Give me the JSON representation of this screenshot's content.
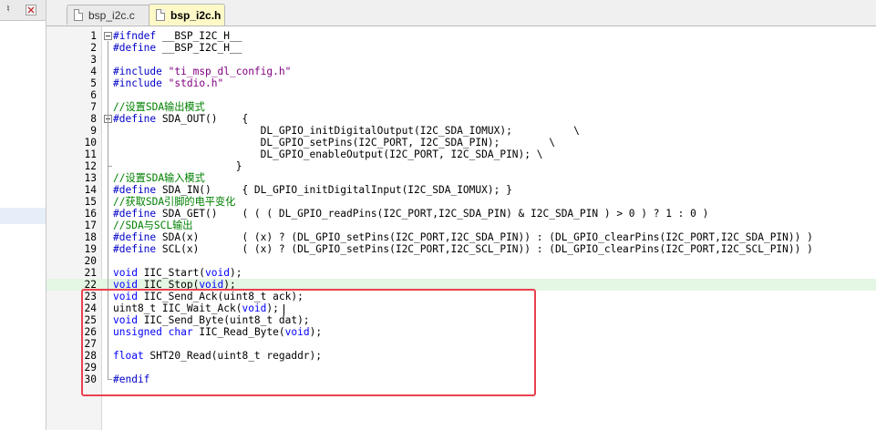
{
  "panel": {
    "pin_icon": "pin-icon",
    "close_icon": "close-icon"
  },
  "tabs": [
    {
      "label": "bsp_i2c.c",
      "active": false
    },
    {
      "label": "bsp_i2c.h",
      "active": true
    }
  ],
  "editor": {
    "current_line": 22,
    "lines": [
      {
        "n": "1",
        "code": "#ifndef __BSP_I2C_H__"
      },
      {
        "n": "2",
        "code": "#define __BSP_I2C_H__"
      },
      {
        "n": "3",
        "code": ""
      },
      {
        "n": "4",
        "code": "#include \"ti_msp_dl_config.h\""
      },
      {
        "n": "5",
        "code": "#include \"stdio.h\""
      },
      {
        "n": "6",
        "code": ""
      },
      {
        "n": "7",
        "code": "//设置SDA输出模式"
      },
      {
        "n": "8",
        "code": "#define SDA_OUT()    {"
      },
      {
        "n": "9",
        "code": "                        DL_GPIO_initDigitalOutput(I2C_SDA_IOMUX);          \\"
      },
      {
        "n": "10",
        "code": "                        DL_GPIO_setPins(I2C_PORT, I2C_SDA_PIN);        \\"
      },
      {
        "n": "11",
        "code": "                        DL_GPIO_enableOutput(I2C_PORT, I2C_SDA_PIN); \\"
      },
      {
        "n": "12",
        "code": "                    }"
      },
      {
        "n": "13",
        "code": "//设置SDA输入模式"
      },
      {
        "n": "14",
        "code": "#define SDA_IN()     { DL_GPIO_initDigitalInput(I2C_SDA_IOMUX); }"
      },
      {
        "n": "15",
        "code": "//获取SDA引脚的电平变化"
      },
      {
        "n": "16",
        "code": "#define SDA_GET()    ( ( ( DL_GPIO_readPins(I2C_PORT,I2C_SDA_PIN) & I2C_SDA_PIN ) > 0 ) ? 1 : 0 )"
      },
      {
        "n": "17",
        "code": "//SDA与SCL输出"
      },
      {
        "n": "18",
        "code": "#define SDA(x)       ( (x) ? (DL_GPIO_setPins(I2C_PORT,I2C_SDA_PIN)) : (DL_GPIO_clearPins(I2C_PORT,I2C_SDA_PIN)) )"
      },
      {
        "n": "19",
        "code": "#define SCL(x)       ( (x) ? (DL_GPIO_setPins(I2C_PORT,I2C_SCL_PIN)) : (DL_GPIO_clearPins(I2C_PORT,I2C_SCL_PIN)) )"
      },
      {
        "n": "20",
        "code": ""
      },
      {
        "n": "21",
        "code": "void IIC_Start(void);"
      },
      {
        "n": "22",
        "code": "void IIC_Stop(void);"
      },
      {
        "n": "23",
        "code": "void IIC_Send_Ack(uint8_t ack);"
      },
      {
        "n": "24",
        "code": "uint8_t IIC_Wait_Ack(void);"
      },
      {
        "n": "25",
        "code": "void IIC_Send_Byte(uint8_t dat);"
      },
      {
        "n": "26",
        "code": "unsigned char IIC_Read_Byte(void);"
      },
      {
        "n": "27",
        "code": ""
      },
      {
        "n": "28",
        "code": "float SHT20_Read(uint8_t regaddr);"
      },
      {
        "n": "29",
        "code": ""
      },
      {
        "n": "30",
        "code": "#endif"
      }
    ]
  },
  "colors": {
    "keyword": "#0000ff",
    "string": "#800080",
    "comment": "#008000",
    "highlight_box": "#e9414f",
    "active_tab": "#fff9c8",
    "current_line": "#e4f6e4"
  }
}
